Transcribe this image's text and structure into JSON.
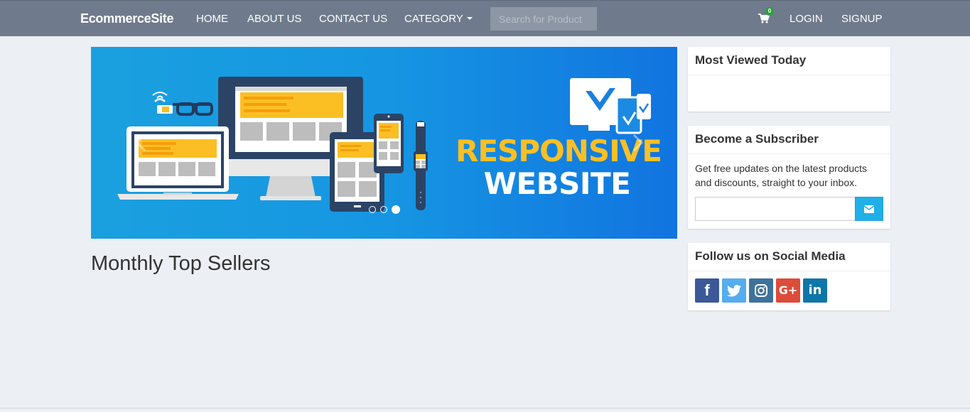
{
  "navbar": {
    "brand": "EcommerceSite",
    "links": {
      "home": "HOME",
      "about": "ABOUT US",
      "contact": "CONTACT US",
      "category": "CATEGORY"
    },
    "search_placeholder": "Search for Product",
    "cart_count": "0",
    "login": "LOGIN",
    "signup": "SIGNUP"
  },
  "carousel": {
    "headline_line1": "RESPONSIVE",
    "headline_line2": "WEBSITE",
    "slide_count": 3,
    "active_slide": 3,
    "colors": {
      "bg_start": "#1aa0df",
      "bg_end": "#1174e0",
      "accent": "#fbbf24"
    }
  },
  "main": {
    "section_title": "Monthly Top Sellers"
  },
  "sidebar": {
    "most_viewed": {
      "title": "Most Viewed Today"
    },
    "subscriber": {
      "title": "Become a Subscriber",
      "text": "Get free updates on the latest products and discounts, straight to your inbox.",
      "email_value": "",
      "button_icon": "envelope-icon"
    },
    "social": {
      "title": "Follow us on Social Media",
      "networks": [
        {
          "name": "facebook-icon",
          "glyph": "f",
          "color": "#3b5998"
        },
        {
          "name": "twitter-icon",
          "glyph": "",
          "color": "#55acee"
        },
        {
          "name": "instagram-icon",
          "glyph": "",
          "color": "#3f729b"
        },
        {
          "name": "google-plus-icon",
          "glyph": "G+",
          "color": "#dd4b39"
        },
        {
          "name": "linkedin-icon",
          "glyph": "in",
          "color": "#0e76a8"
        }
      ]
    }
  }
}
